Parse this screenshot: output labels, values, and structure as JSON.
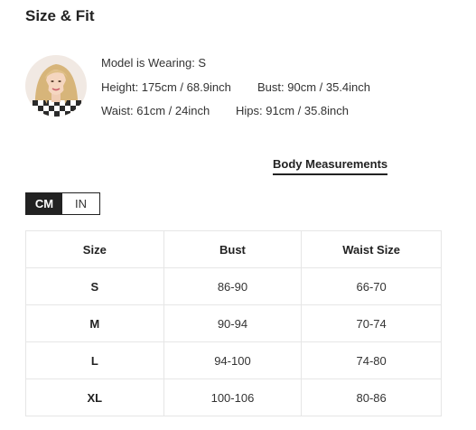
{
  "section_title": "Size & Fit",
  "model": {
    "wearing": "Model is Wearing: S",
    "height": "Height: 175cm / 68.9inch",
    "bust": "Bust: 90cm / 35.4inch",
    "waist": "Waist: 61cm / 24inch",
    "hips": "Hips: 91cm / 35.8inch"
  },
  "tabs": {
    "body_measurements": "Body Measurements"
  },
  "units": {
    "cm": "CM",
    "in": "IN",
    "selected": "CM"
  },
  "table": {
    "headers": [
      "Size",
      "Bust",
      "Waist Size"
    ],
    "rows": [
      [
        "S",
        "86-90",
        "66-70"
      ],
      [
        "M",
        "90-94",
        "70-74"
      ],
      [
        "L",
        "94-100",
        "74-80"
      ],
      [
        "XL",
        "100-106",
        "80-86"
      ]
    ]
  },
  "colors": {
    "accent": "#222222",
    "border": "#e6e6e6"
  },
  "icons": {
    "avatar": "model-photo"
  }
}
